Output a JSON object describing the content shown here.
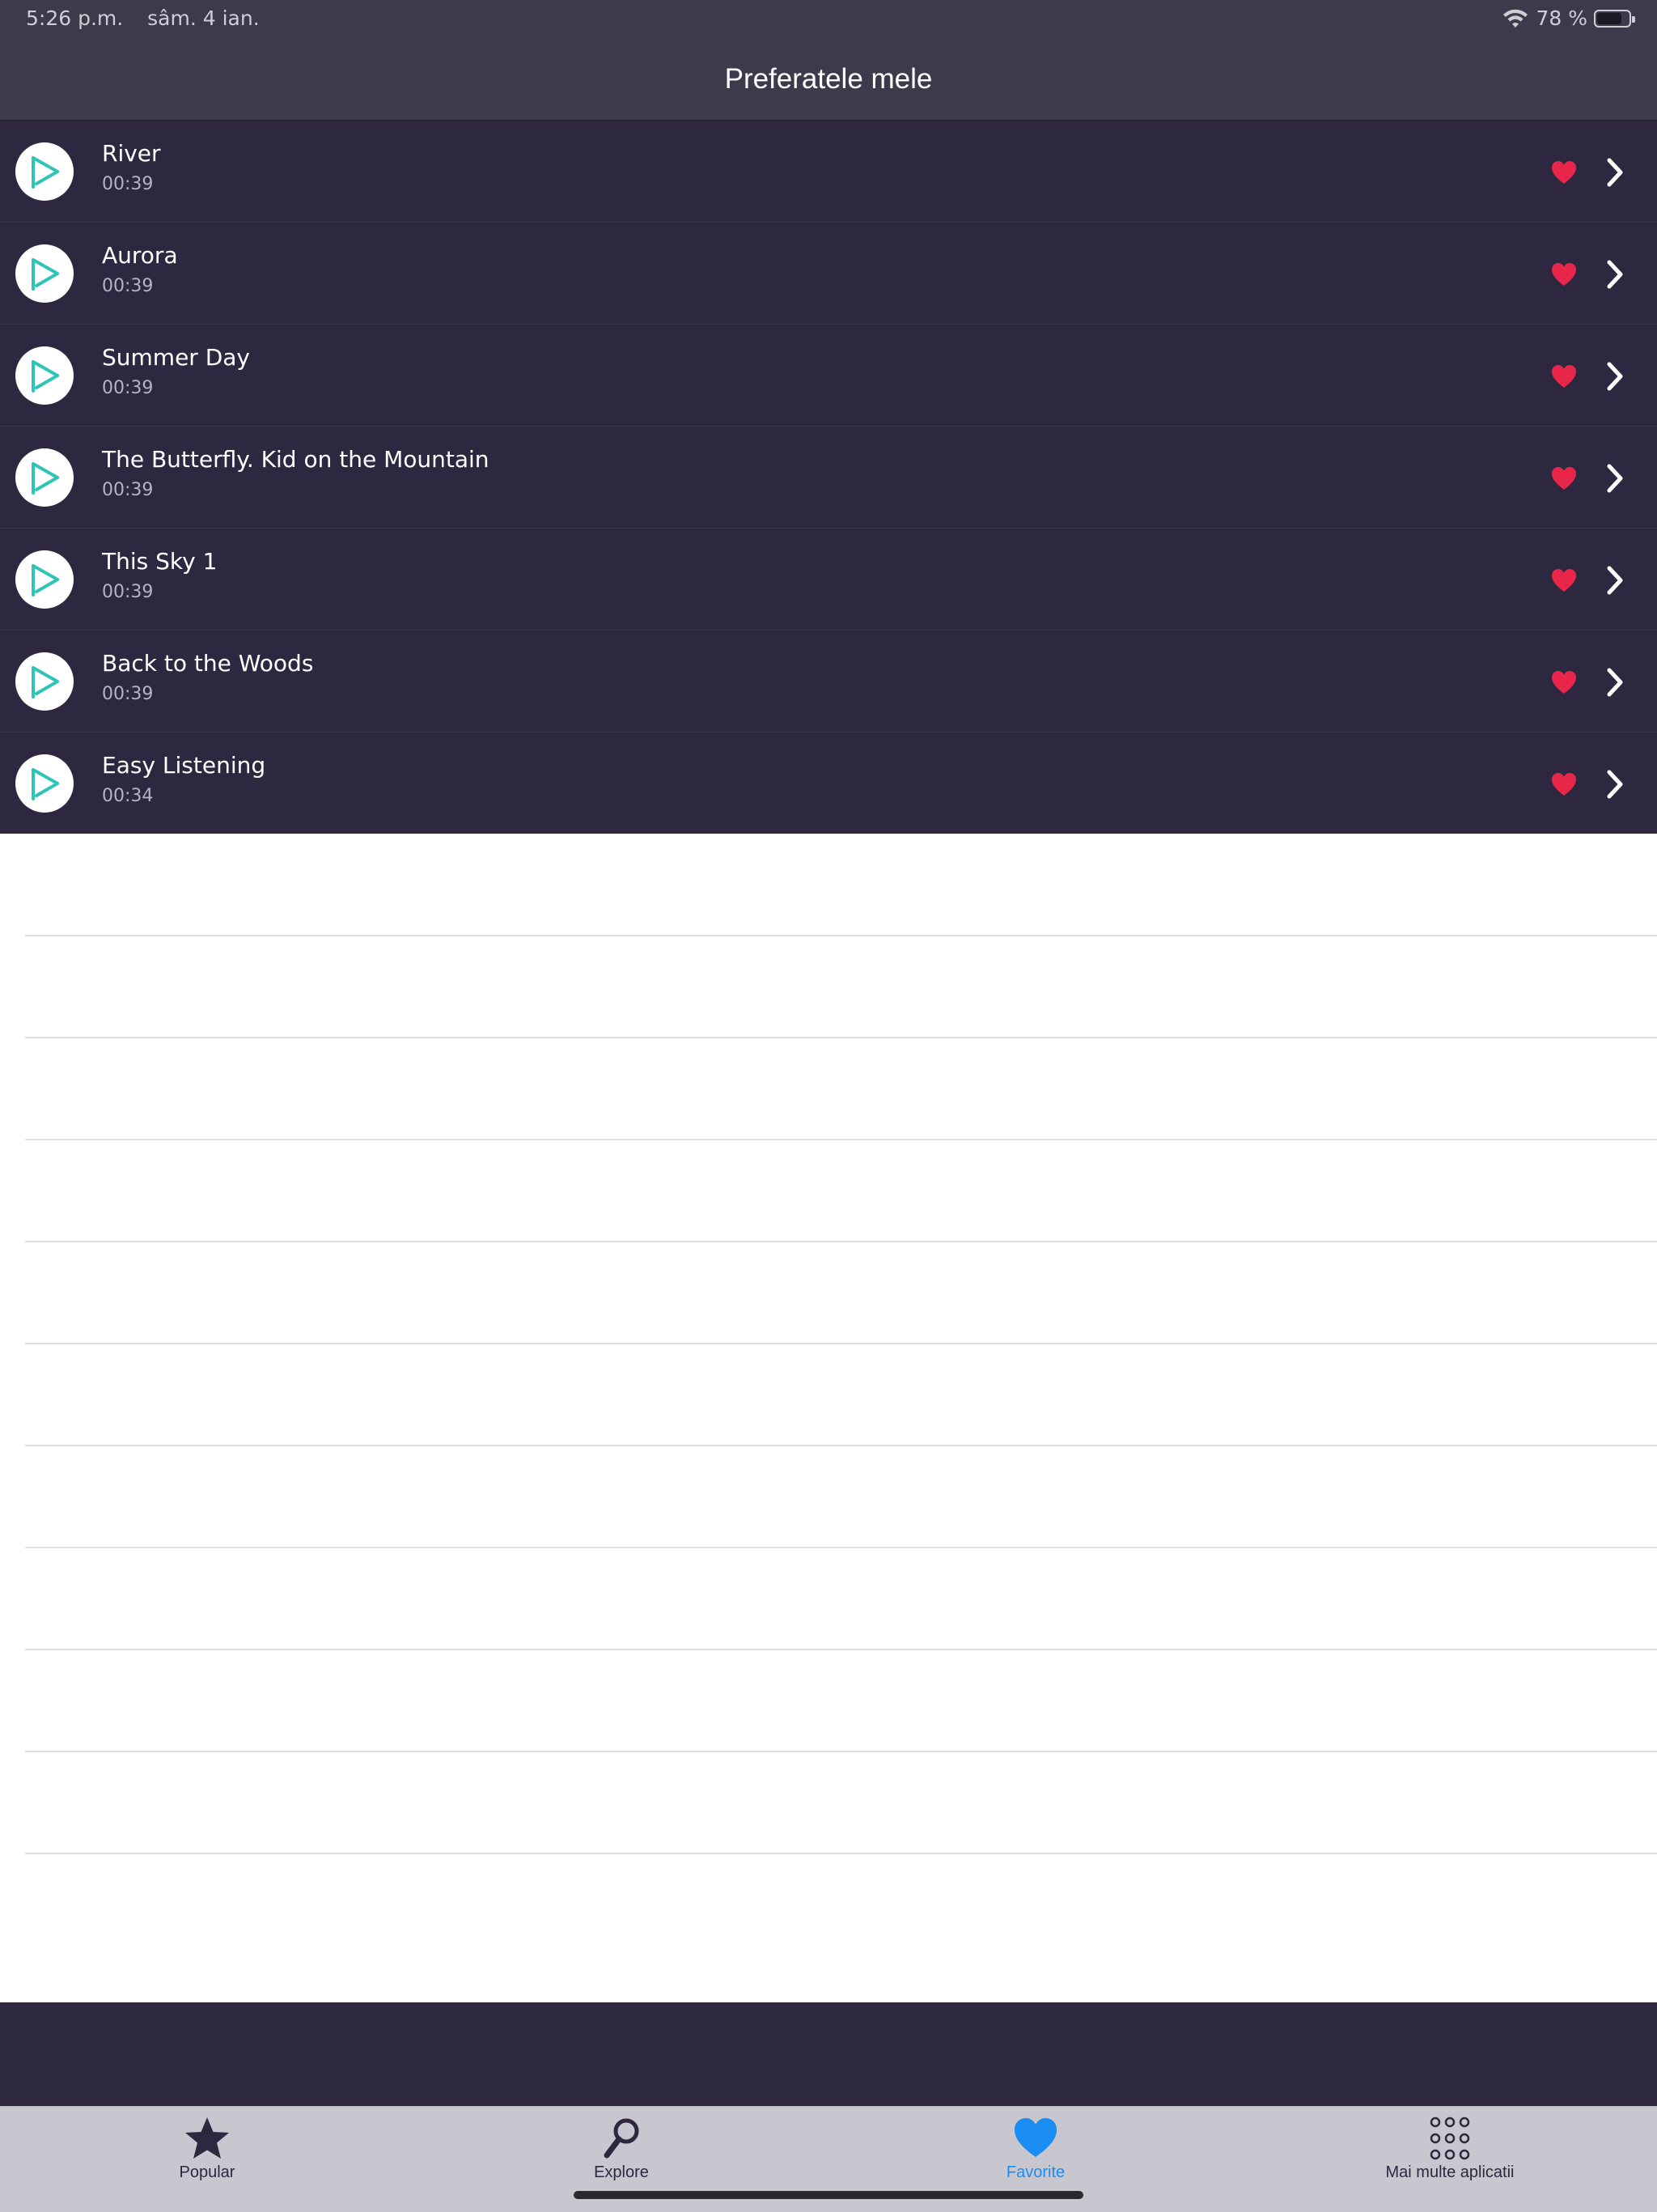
{
  "status_bar": {
    "time": "5:26 p.m.",
    "date": "sâm. 4 ian.",
    "battery_percent_label": "78 %",
    "battery_level": 0.78
  },
  "nav": {
    "title": "Preferatele mele"
  },
  "favorites": [
    {
      "title": "River",
      "duration": "00:39"
    },
    {
      "title": "Aurora",
      "duration": "00:39"
    },
    {
      "title": "Summer Day",
      "duration": "00:39"
    },
    {
      "title": "The Butterfly. Kid on the Mountain",
      "duration": "00:39"
    },
    {
      "title": "This Sky 1",
      "duration": "00:39"
    },
    {
      "title": "Back to the Woods",
      "duration": "00:39"
    },
    {
      "title": "Easy Listening",
      "duration": "00:34"
    }
  ],
  "tabs": [
    {
      "label": "Popular",
      "icon": "star-icon"
    },
    {
      "label": "Explore",
      "icon": "magnifier-icon"
    },
    {
      "label": "Favorite",
      "icon": "heart-icon",
      "active": true
    },
    {
      "label": "Mai multe aplicatii",
      "icon": "apps-grid-icon"
    }
  ],
  "colors": {
    "accent_teal": "#2ec4b6",
    "heart_red": "#e8264a",
    "active_tab_blue": "#1b8cf2",
    "list_background": "#2e2740",
    "header_background": "#3d3a4b"
  }
}
